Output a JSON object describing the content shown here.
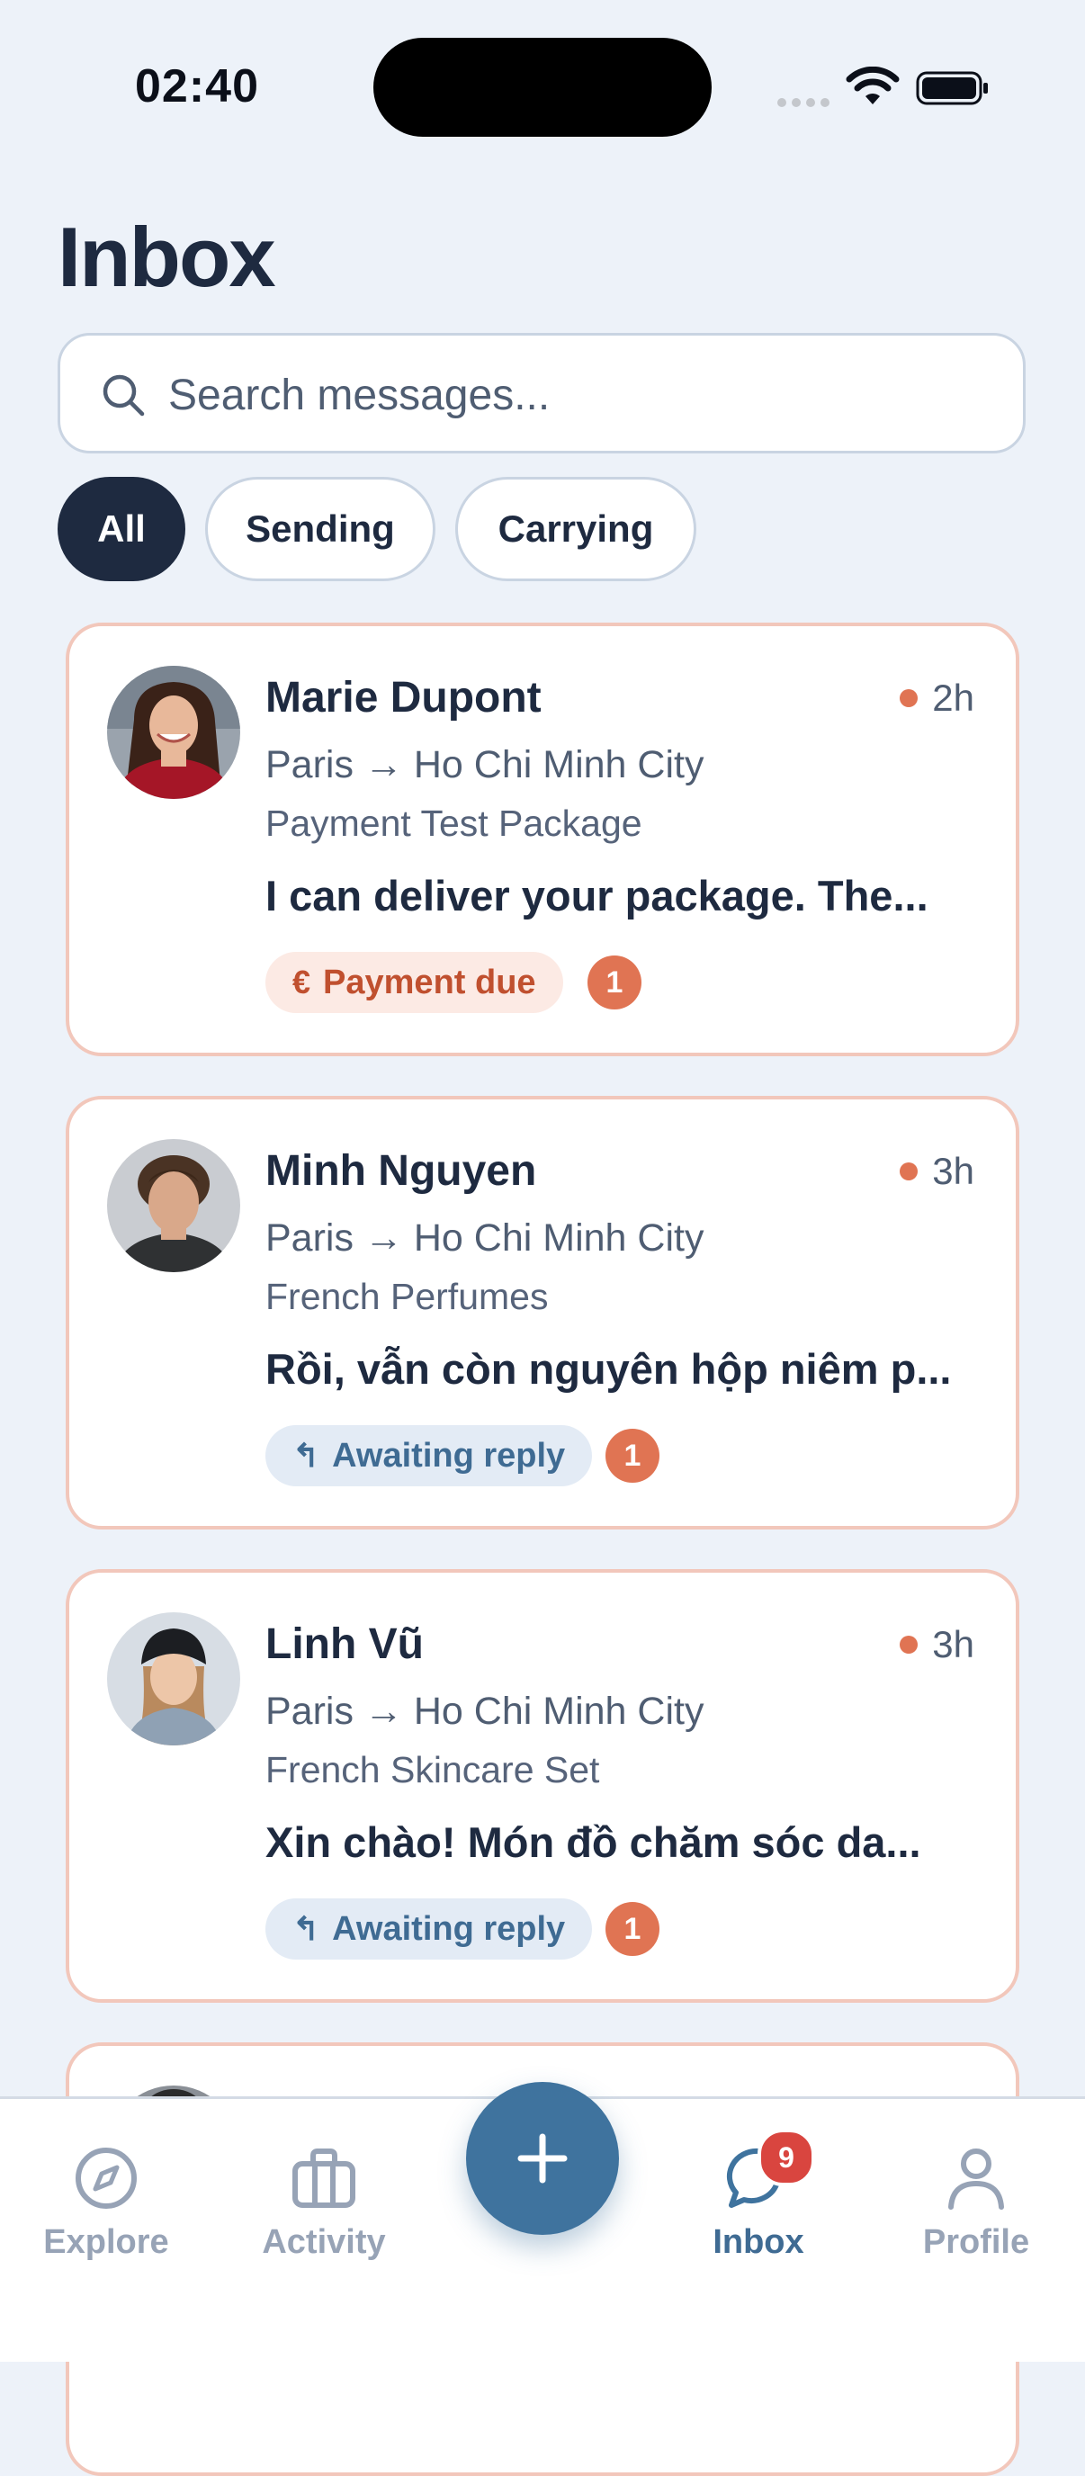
{
  "status_bar": {
    "time": "02:40"
  },
  "page": {
    "title": "Inbox"
  },
  "search": {
    "placeholder": "Search messages..."
  },
  "filters": [
    {
      "label": "All",
      "active": true
    },
    {
      "label": "Sending",
      "active": false
    },
    {
      "label": "Carrying",
      "active": false
    }
  ],
  "conversations": [
    {
      "name": "Marie Dupont",
      "time": "2h",
      "route": "Paris → Ho Chi Minh City",
      "package": "Payment Test Package",
      "message": "I can deliver your package. The...",
      "status": "Payment due",
      "status_icon": "€",
      "unread_count": "1"
    },
    {
      "name": "Minh Nguyen",
      "time": "3h",
      "route": "Paris → Ho Chi Minh City",
      "package": "French Perfumes",
      "message": "Rồi, vẫn còn nguyên hộp niêm p...",
      "status": "Awaiting reply",
      "status_icon": "↰",
      "unread_count": "1"
    },
    {
      "name": "Linh Vũ",
      "time": "3h",
      "route": "Paris → Ho Chi Minh City",
      "package": "French Skincare Set",
      "message": "Xin chào! Món đồ chăm sóc da...",
      "status": "Awaiting reply",
      "status_icon": "↰",
      "unread_count": "1"
    }
  ],
  "tab_bar": {
    "explore": "Explore",
    "activity": "Activity",
    "inbox": "Inbox",
    "profile": "Profile",
    "inbox_badge": "9",
    "active": "Inbox"
  },
  "colors": {
    "background": "#edf2f9",
    "primary_dark": "#1e2a40",
    "accent_blue": "#3f739e",
    "alert_orange": "#e07453",
    "badge_red": "#d9453f"
  }
}
